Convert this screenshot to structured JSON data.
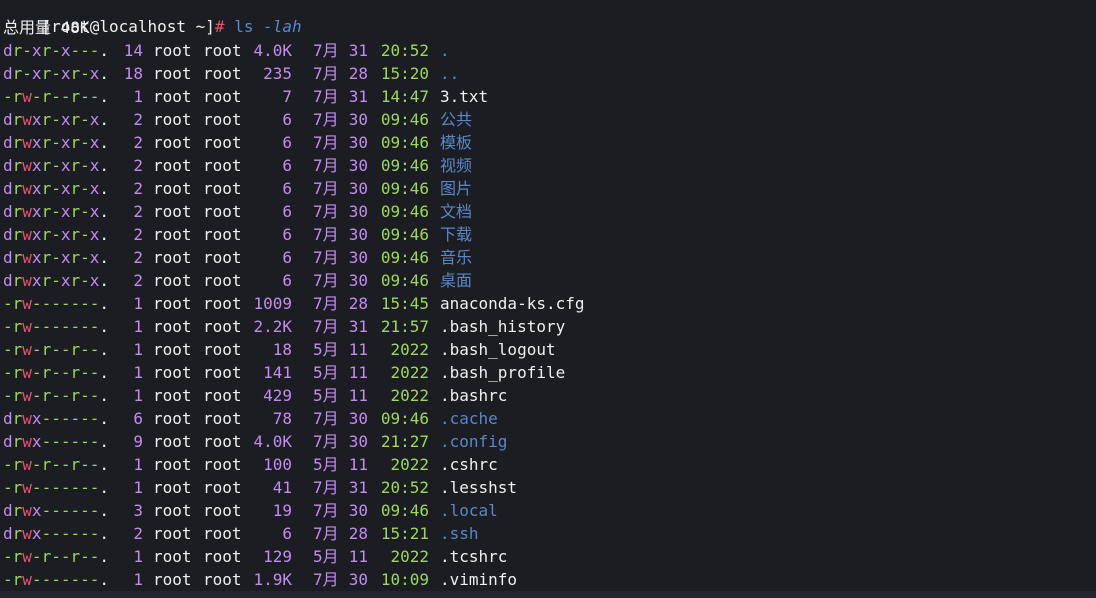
{
  "colors": {
    "background": "#1b1d23",
    "text": "#f0f0f0",
    "perm_read": "#9cd95b",
    "perm_write": "#e4536b",
    "perm_exec": "#c58bf0",
    "perm_dir": "#c58bf0",
    "perm_dash": "#9cd95b",
    "count": "#c58bf0",
    "size": "#c58bf0",
    "month": "#c58bf0",
    "day": "#c58bf0",
    "time": "#9cd95b",
    "dir_name": "#5a87c8",
    "file_name": "#f0f0f0",
    "prompt_hash": "#e4536b",
    "command": "#5a87c8",
    "cursor": "#f5a623"
  },
  "prompt": {
    "user_host": "[root@localhost ~]",
    "symbol": "#",
    "command": "ls",
    "args": "-lah"
  },
  "total_line": "总用量 48K",
  "entries": [
    {
      "perms": "dr-xr-x---.",
      "links": "14",
      "user": "root",
      "group": "root",
      "size": "4.0K",
      "month": "7月",
      "day": "31",
      "time": "20:52",
      "name": ".",
      "is_dir": true
    },
    {
      "perms": "dr-xr-xr-x.",
      "links": "18",
      "user": "root",
      "group": "root",
      "size": "235",
      "month": "7月",
      "day": "28",
      "time": "15:20",
      "name": "..",
      "is_dir": true
    },
    {
      "perms": "-rw-r--r--.",
      "links": "1",
      "user": "root",
      "group": "root",
      "size": "7",
      "month": "7月",
      "day": "31",
      "time": "14:47",
      "name": "3.txt",
      "is_dir": false
    },
    {
      "perms": "drwxr-xr-x.",
      "links": "2",
      "user": "root",
      "group": "root",
      "size": "6",
      "month": "7月",
      "day": "30",
      "time": "09:46",
      "name": "公共",
      "is_dir": true
    },
    {
      "perms": "drwxr-xr-x.",
      "links": "2",
      "user": "root",
      "group": "root",
      "size": "6",
      "month": "7月",
      "day": "30",
      "time": "09:46",
      "name": "模板",
      "is_dir": true
    },
    {
      "perms": "drwxr-xr-x.",
      "links": "2",
      "user": "root",
      "group": "root",
      "size": "6",
      "month": "7月",
      "day": "30",
      "time": "09:46",
      "name": "视频",
      "is_dir": true
    },
    {
      "perms": "drwxr-xr-x.",
      "links": "2",
      "user": "root",
      "group": "root",
      "size": "6",
      "month": "7月",
      "day": "30",
      "time": "09:46",
      "name": "图片",
      "is_dir": true
    },
    {
      "perms": "drwxr-xr-x.",
      "links": "2",
      "user": "root",
      "group": "root",
      "size": "6",
      "month": "7月",
      "day": "30",
      "time": "09:46",
      "name": "文档",
      "is_dir": true
    },
    {
      "perms": "drwxr-xr-x.",
      "links": "2",
      "user": "root",
      "group": "root",
      "size": "6",
      "month": "7月",
      "day": "30",
      "time": "09:46",
      "name": "下载",
      "is_dir": true
    },
    {
      "perms": "drwxr-xr-x.",
      "links": "2",
      "user": "root",
      "group": "root",
      "size": "6",
      "month": "7月",
      "day": "30",
      "time": "09:46",
      "name": "音乐",
      "is_dir": true
    },
    {
      "perms": "drwxr-xr-x.",
      "links": "2",
      "user": "root",
      "group": "root",
      "size": "6",
      "month": "7月",
      "day": "30",
      "time": "09:46",
      "name": "桌面",
      "is_dir": true
    },
    {
      "perms": "-rw-------.",
      "links": "1",
      "user": "root",
      "group": "root",
      "size": "1009",
      "month": "7月",
      "day": "28",
      "time": "15:45",
      "name": "anaconda-ks.cfg",
      "is_dir": false
    },
    {
      "perms": "-rw-------.",
      "links": "1",
      "user": "root",
      "group": "root",
      "size": "2.2K",
      "month": "7月",
      "day": "31",
      "time": "21:57",
      "name": ".bash_history",
      "is_dir": false
    },
    {
      "perms": "-rw-r--r--.",
      "links": "1",
      "user": "root",
      "group": "root",
      "size": "18",
      "month": "5月",
      "day": "11",
      "time": " 2022",
      "name": ".bash_logout",
      "is_dir": false
    },
    {
      "perms": "-rw-r--r--.",
      "links": "1",
      "user": "root",
      "group": "root",
      "size": "141",
      "month": "5月",
      "day": "11",
      "time": " 2022",
      "name": ".bash_profile",
      "is_dir": false
    },
    {
      "perms": "-rw-r--r--.",
      "links": "1",
      "user": "root",
      "group": "root",
      "size": "429",
      "month": "5月",
      "day": "11",
      "time": " 2022",
      "name": ".bashrc",
      "is_dir": false
    },
    {
      "perms": "drwx------.",
      "links": "6",
      "user": "root",
      "group": "root",
      "size": "78",
      "month": "7月",
      "day": "30",
      "time": "09:46",
      "name": ".cache",
      "is_dir": true
    },
    {
      "perms": "drwx------.",
      "links": "9",
      "user": "root",
      "group": "root",
      "size": "4.0K",
      "month": "7月",
      "day": "30",
      "time": "21:27",
      "name": ".config",
      "is_dir": true
    },
    {
      "perms": "-rw-r--r--.",
      "links": "1",
      "user": "root",
      "group": "root",
      "size": "100",
      "month": "5月",
      "day": "11",
      "time": " 2022",
      "name": ".cshrc",
      "is_dir": false
    },
    {
      "perms": "-rw-------.",
      "links": "1",
      "user": "root",
      "group": "root",
      "size": "41",
      "month": "7月",
      "day": "31",
      "time": "20:52",
      "name": ".lesshst",
      "is_dir": false
    },
    {
      "perms": "drwx------.",
      "links": "3",
      "user": "root",
      "group": "root",
      "size": "19",
      "month": "7月",
      "day": "30",
      "time": "09:46",
      "name": ".local",
      "is_dir": true
    },
    {
      "perms": "drwx------.",
      "links": "2",
      "user": "root",
      "group": "root",
      "size": "6",
      "month": "7月",
      "day": "28",
      "time": "15:21",
      "name": ".ssh",
      "is_dir": true
    },
    {
      "perms": "-rw-r--r--.",
      "links": "1",
      "user": "root",
      "group": "root",
      "size": "129",
      "month": "5月",
      "day": "11",
      "time": " 2022",
      "name": ".tcshrc",
      "is_dir": false
    },
    {
      "perms": "-rw-------.",
      "links": "1",
      "user": "root",
      "group": "root",
      "size": "1.9K",
      "month": "7月",
      "day": "30",
      "time": "10:09",
      "name": ".viminfo",
      "is_dir": false
    }
  ],
  "bottom_prompt": {
    "symbol": "#",
    "cursor_icon": "block-cursor-icon"
  }
}
